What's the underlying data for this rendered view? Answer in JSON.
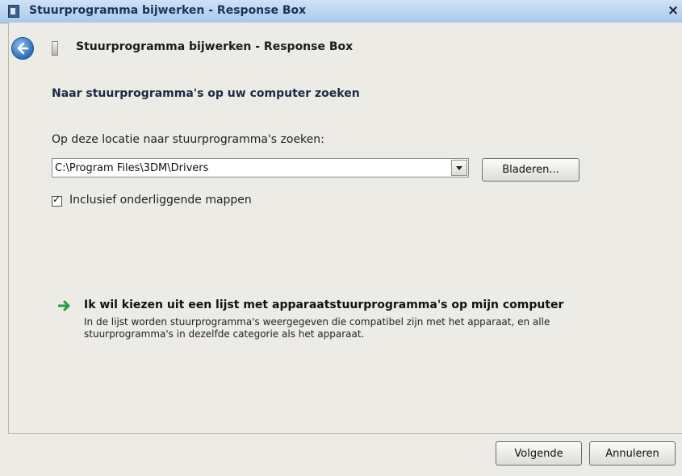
{
  "window": {
    "title": "Stuurprogramma bijwerken - Response Box",
    "close_label": "×"
  },
  "wizard": {
    "title": "Stuurprogramma bijwerken - Response Box",
    "heading": "Naar stuurprogramma's op uw computer zoeken",
    "location_label": "Op deze locatie naar stuurprogramma's zoeken:",
    "path_value": "C:\\Program Files\\3DM\\Drivers",
    "browse_label": "Bladeren...",
    "include_subfolders_label": "Inclusief onderliggende mappen",
    "include_subfolders_checked": true,
    "pick_link": {
      "title": "Ik wil kiezen uit een lijst met apparaatstuurprogramma's op mijn computer",
      "description": "In de lijst worden stuurprogramma's weergegeven die compatibel zijn met het apparaat, en alle stuurprogramma's in dezelfde categorie als het apparaat."
    }
  },
  "footer": {
    "next_label": "Volgende",
    "cancel_label": "Annuleren"
  },
  "icons": {
    "window_icon": "device-icon",
    "back": "back-arrow-icon",
    "wizard_icon": "device-icon",
    "link_arrow": "green-arrow-icon"
  },
  "colors": {
    "titlebar": "#a9c9ec",
    "background": "#ecebe6",
    "link_arrow": "#2e9a3b"
  }
}
